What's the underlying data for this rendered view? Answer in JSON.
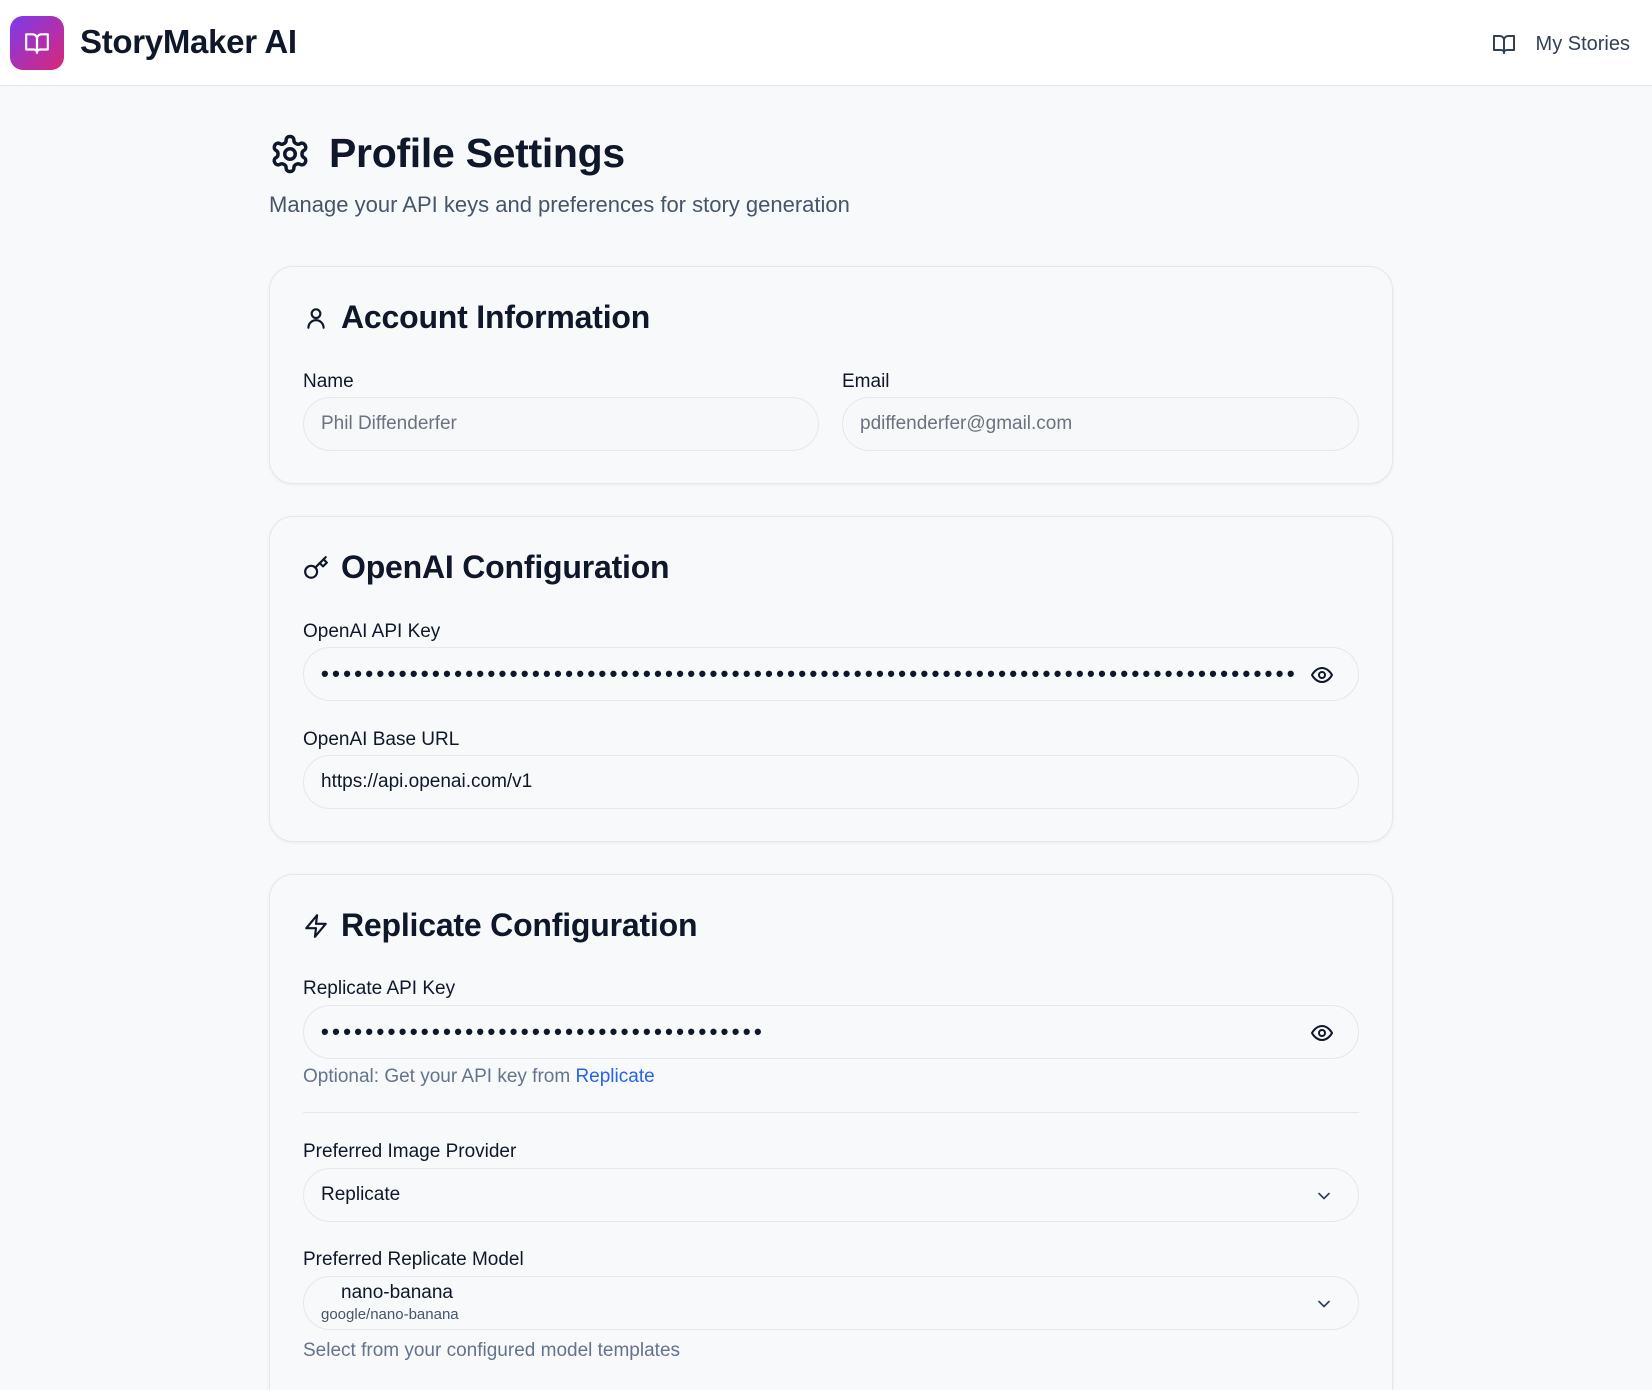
{
  "header": {
    "app_title": "StoryMaker AI",
    "my_stories": "My Stories",
    "logo_icon": "book-open-icon",
    "logo_gradient": [
      "#7c3aed",
      "#db2777"
    ]
  },
  "page": {
    "title": "Profile Settings",
    "subtitle": "Manage your API keys and preferences for story generation"
  },
  "account": {
    "title": "Account Information",
    "name_label": "Name",
    "name_value": "Phil Diffenderfer",
    "email_label": "Email",
    "email_value": "pdiffenderfer@gmail.com"
  },
  "openai": {
    "title": "OpenAI Configuration",
    "api_key_label": "OpenAI API Key",
    "api_key_masked": "•••••••••••••••••••••••••••••••••••••••••••••••••••••••••••••••••••••••••••••••••••••••••••••",
    "base_url_label": "OpenAI Base URL",
    "base_url_value": "https://api.openai.com/v1"
  },
  "replicate": {
    "title": "Replicate Configuration",
    "api_key_label": "Replicate API Key",
    "api_key_masked": "••••••••••••••••••••••••••••••••••••••••",
    "hint_prefix": "Optional: Get your API key from ",
    "hint_link": "Replicate",
    "provider_label": "Preferred Image Provider",
    "provider_value": "Replicate",
    "model_label": "Preferred Replicate Model",
    "model_name": "nano-banana",
    "model_id": "google/nano-banana",
    "model_hint": "Select from your configured model templates"
  },
  "colors": {
    "accent": "#2563eb",
    "background": "#f8f9fb",
    "text": "#0f172a"
  }
}
